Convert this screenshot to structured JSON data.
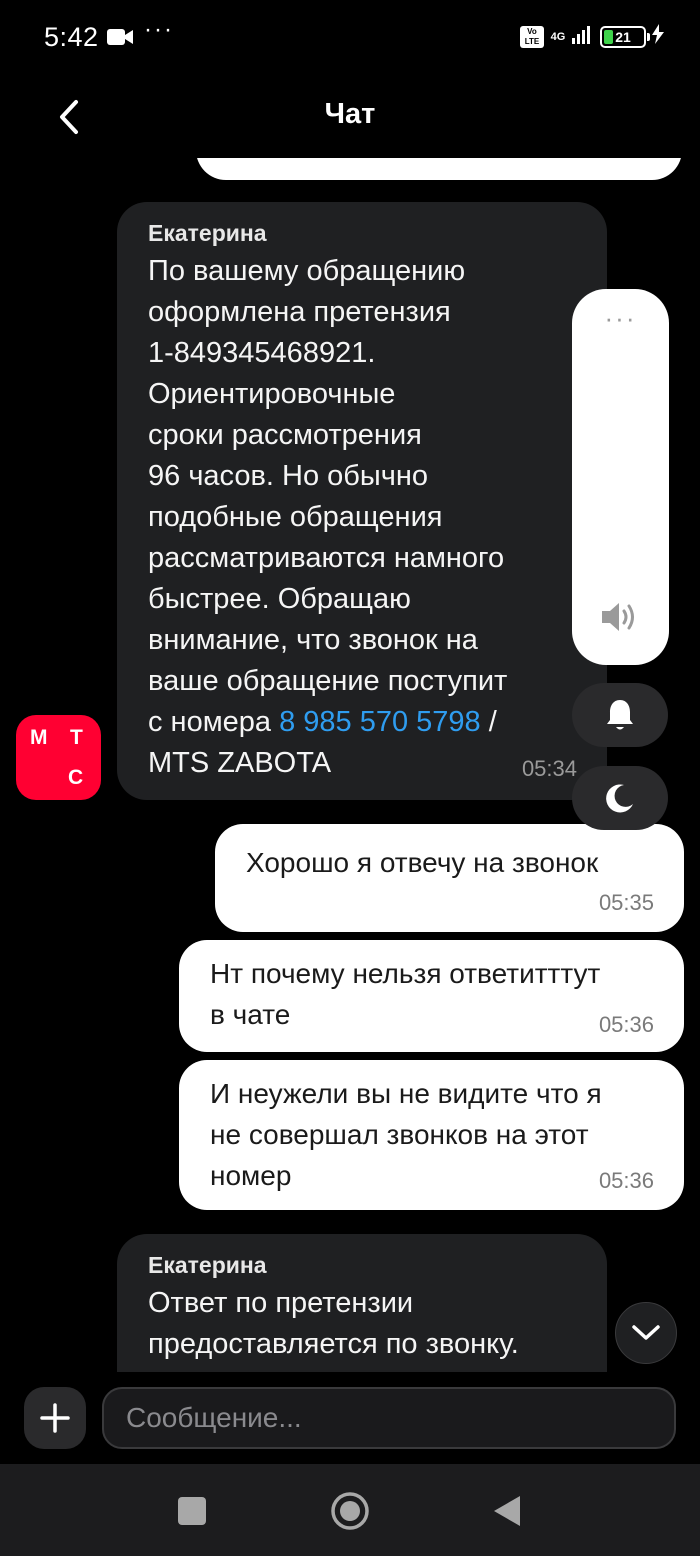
{
  "status_bar": {
    "time": "5:42",
    "dots": "···",
    "volte": "Vo LTE",
    "network": "4G",
    "battery": "21"
  },
  "header": {
    "title": "Чат"
  },
  "avatar": {
    "letters": [
      "М",
      "Т",
      "С"
    ],
    "color": "#ff0032"
  },
  "messages": [
    {
      "direction": "in",
      "sender": "Екатерина",
      "text_lines": [
        "По вашему обращению",
        "оформлена претензия",
        "1-849345468921.",
        "Ориентировочные",
        "сроки рассмотрения",
        "96 часов. Но обычно",
        "подобные обращения",
        "рассматриваются намного",
        "быстрее. Обращаю",
        "внимание, что звонок на",
        "ваше обращение поступит"
      ],
      "text_prefix": "с номера",
      "phone": "8 985 570 5798",
      "text_suffix": "/",
      "last_line": "MTS ZABOTA",
      "time": "05:34"
    },
    {
      "direction": "out",
      "text_lines": [
        "Хорошо я  отвечу на звонок"
      ],
      "time": "05:35"
    },
    {
      "direction": "out",
      "text_lines": [
        "Нт почему нельзя ответитттут",
        "в чате"
      ],
      "time": "05:36"
    },
    {
      "direction": "out",
      "text_lines": [
        "И неужели вы не видите что я",
        "не совершал звонков на этот",
        "номер"
      ],
      "time": "05:36"
    },
    {
      "direction": "in",
      "sender": "Екатерина",
      "text_lines": [
        "Ответ по претензии",
        "предоставляется по звонку."
      ]
    }
  ],
  "volume_panel": {
    "dots": "···"
  },
  "input": {
    "placeholder": "Сообщение..."
  },
  "colors": {
    "accent_link": "#2f9df0",
    "brand_red": "#ff0032",
    "battery_green": "#3fd34b"
  }
}
